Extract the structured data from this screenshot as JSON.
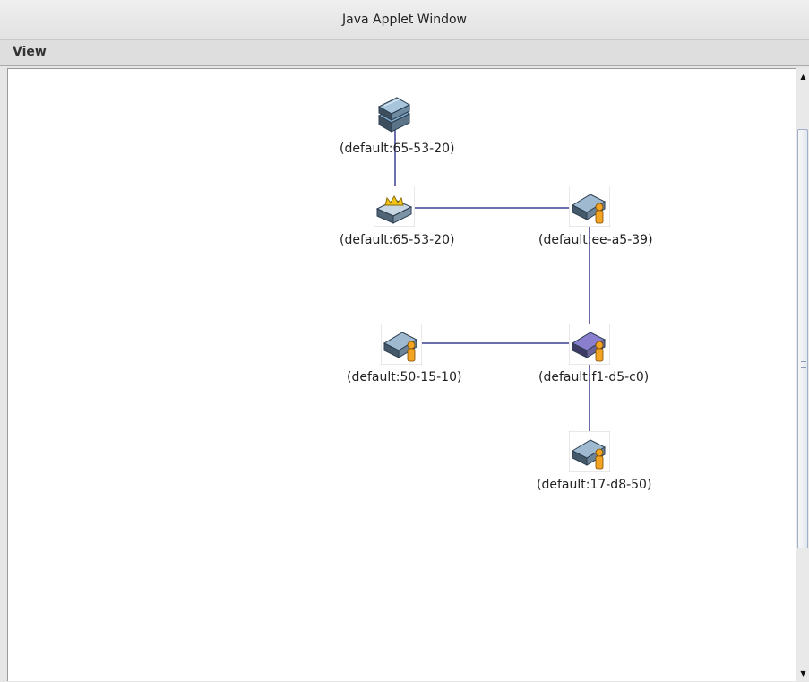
{
  "window": {
    "title": "Java Applet Window"
  },
  "menu": {
    "items": [
      {
        "label": "View"
      }
    ]
  },
  "topology": {
    "link_color": "#3a3f8f",
    "nodes": [
      {
        "id": "n1",
        "label": "(default:65-53-20)",
        "icon": "stacked-switch-icon"
      },
      {
        "id": "n2",
        "label": "(default:65-53-20)",
        "icon": "root-switch-crown-icon"
      },
      {
        "id": "n3",
        "label": "(default:ee-a5-39)",
        "icon": "switch-user-icon"
      },
      {
        "id": "n4",
        "label": "(default:50-15-10)",
        "icon": "switch-user-icon"
      },
      {
        "id": "n5",
        "label": "(default:f1-d5-c0)",
        "icon": "purple-switch-user-icon"
      },
      {
        "id": "n6",
        "label": "(default:17-d8-50)",
        "icon": "switch-user-icon"
      }
    ],
    "links": [
      [
        "n1",
        "n2"
      ],
      [
        "n2",
        "n3"
      ],
      [
        "n3",
        "n5"
      ],
      [
        "n4",
        "n5"
      ],
      [
        "n5",
        "n6"
      ]
    ]
  }
}
